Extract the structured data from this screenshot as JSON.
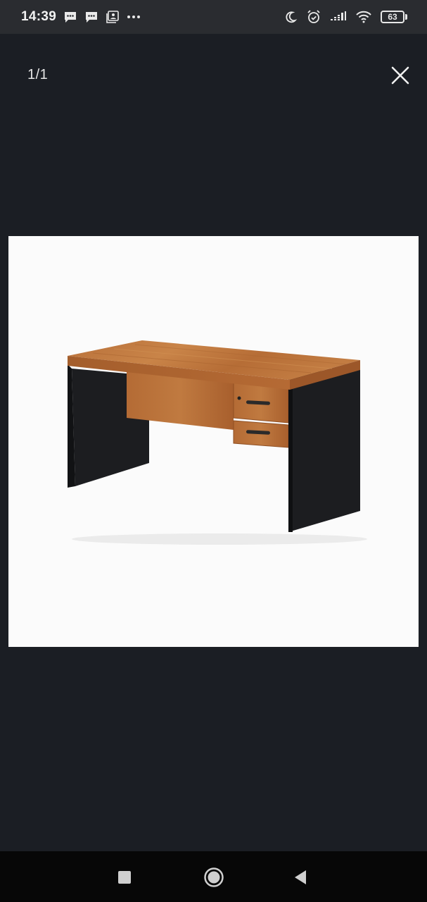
{
  "status_bar": {
    "time": "14:39",
    "left_icons": [
      "message-icon",
      "message-icon",
      "gallery-icon",
      "more-dots-icon"
    ],
    "right_icons": [
      "moon-icon",
      "alarm-icon",
      "signal-icon",
      "wifi-icon",
      "battery-icon"
    ],
    "battery_level": "63"
  },
  "viewer": {
    "counter": "1/1",
    "close_icon": "close-icon"
  },
  "photo": {
    "subject": "office-desk-image"
  },
  "nav_bar": {
    "buttons": [
      "recents-square-icon",
      "home-circle-icon",
      "back-triangle-icon"
    ]
  },
  "colors": {
    "background": "#1b1e24",
    "status_bar": "#2a2c30",
    "nav_bar": "#070707",
    "photo_bg": "#fbfbfb"
  }
}
